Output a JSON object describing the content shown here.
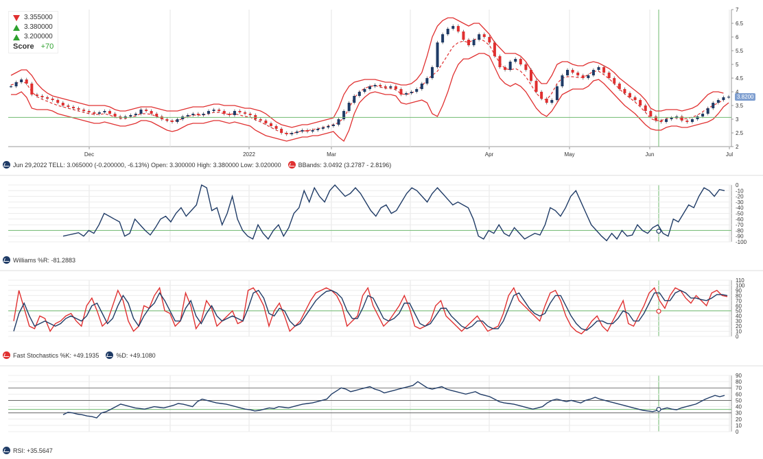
{
  "legend": {
    "items": [
      {
        "type": "down",
        "value": "3.355000"
      },
      {
        "type": "up",
        "value": "3.380000"
      },
      {
        "type": "up",
        "value": "3.200000"
      }
    ],
    "score_label": "Score",
    "score_value": "+70"
  },
  "price_caption": "Jun 29,2022 TELL: 3.065000 (-0.200000, -6.13%) Open: 3.300000 High: 3.380000 Low: 3.020000",
  "bbands_caption": "BBands: 3.0492  (3.2787  - 2.8196)",
  "williams_caption": "Williams %R: -81.2883",
  "stoch_k_caption": "Fast Stochastics %K: +49.1935",
  "stoch_d_caption": "%D: +49.1080",
  "rsi_caption": "RSI: +35.5647",
  "last_price_tag": "3.8200",
  "colors": {
    "price_up": "#1f3b66",
    "price_down": "#e03030",
    "band": "#e03030",
    "indicator": "#1f3b66",
    "crosshair": "#6fba6f"
  },
  "chart_data": [
    {
      "type": "line",
      "title": "",
      "series_name": "TELL",
      "x_ticks": [
        "Dec",
        "2022",
        "Mar",
        "Apr",
        "May",
        "Jun",
        "Jul"
      ],
      "y_ticks": [
        2,
        2.5,
        3,
        3.5,
        4,
        4.5,
        5,
        5.5,
        6,
        6.5,
        7
      ],
      "ylim": [
        2,
        7
      ],
      "close": [
        4.2,
        4.35,
        4.45,
        4.3,
        3.9,
        3.85,
        3.8,
        3.75,
        3.7,
        3.6,
        3.5,
        3.45,
        3.4,
        3.35,
        3.3,
        3.25,
        3.2,
        3.25,
        3.3,
        3.2,
        3.1,
        3.05,
        3.1,
        3.15,
        3.2,
        3.35,
        3.3,
        3.2,
        3.1,
        3.0,
        2.95,
        2.9,
        3.0,
        3.1,
        3.15,
        3.2,
        3.15,
        3.2,
        3.3,
        3.35,
        3.3,
        3.2,
        3.15,
        3.3,
        3.25,
        3.2,
        3.15,
        3.0,
        2.95,
        2.85,
        2.75,
        2.65,
        2.5,
        2.45,
        2.5,
        2.55,
        2.6,
        2.55,
        2.6,
        2.65,
        2.7,
        2.75,
        2.8,
        3.0,
        3.3,
        3.6,
        3.85,
        4.0,
        4.1,
        4.2,
        4.25,
        4.2,
        4.15,
        4.2,
        4.1,
        3.9,
        3.95,
        4.0,
        4.1,
        4.3,
        4.5,
        4.9,
        5.8,
        6.1,
        6.3,
        6.4,
        6.2,
        5.9,
        5.7,
        5.9,
        6.1,
        6.0,
        5.8,
        5.3,
        4.9,
        4.8,
        5.1,
        5.2,
        5.0,
        4.8,
        4.4,
        4.0,
        3.75,
        3.6,
        3.7,
        4.2,
        4.6,
        4.8,
        4.7,
        4.6,
        4.5,
        4.6,
        4.8,
        4.9,
        4.7,
        4.5,
        4.3,
        4.1,
        3.95,
        3.8,
        3.7,
        3.5,
        3.3,
        3.1,
        2.95,
        2.9,
        3.0,
        3.05,
        3.1,
        2.95,
        2.9,
        3.0,
        3.1,
        3.2,
        3.4,
        3.6,
        3.7,
        3.8,
        3.82
      ],
      "bb_upper": [
        4.6,
        4.7,
        4.8,
        4.8,
        4.6,
        4.3,
        4.1,
        3.95,
        3.85,
        3.8,
        3.75,
        3.7,
        3.65,
        3.6,
        3.55,
        3.5,
        3.5,
        3.5,
        3.5,
        3.45,
        3.35,
        3.3,
        3.3,
        3.35,
        3.4,
        3.45,
        3.45,
        3.45,
        3.4,
        3.35,
        3.3,
        3.3,
        3.3,
        3.35,
        3.4,
        3.45,
        3.45,
        3.45,
        3.5,
        3.55,
        3.55,
        3.5,
        3.5,
        3.5,
        3.45,
        3.4,
        3.4,
        3.35,
        3.3,
        3.2,
        3.05,
        2.9,
        2.8,
        2.75,
        2.7,
        2.75,
        2.8,
        2.8,
        2.85,
        2.9,
        2.95,
        3.0,
        3.05,
        3.4,
        3.9,
        4.2,
        4.35,
        4.4,
        4.45,
        4.45,
        4.45,
        4.4,
        4.35,
        4.35,
        4.3,
        4.25,
        4.25,
        4.3,
        4.45,
        4.7,
        5.3,
        6.0,
        6.4,
        6.6,
        6.7,
        6.7,
        6.6,
        6.5,
        6.4,
        6.5,
        6.5,
        6.3,
        6.1,
        5.8,
        5.6,
        5.4,
        5.4,
        5.4,
        5.3,
        5.1,
        4.8,
        4.5,
        4.3,
        4.3,
        4.6,
        5.0,
        5.1,
        5.1,
        5.0,
        4.95,
        4.95,
        5.05,
        5.1,
        5.05,
        4.95,
        4.85,
        4.7,
        4.5,
        4.35,
        4.2,
        4.05,
        3.9,
        3.7,
        3.4,
        3.3,
        3.3,
        3.35,
        3.35,
        3.35,
        3.3,
        3.35,
        3.4,
        3.5,
        3.7,
        3.9,
        4.0,
        4.0,
        3.95
      ],
      "bb_lower": [
        3.9,
        3.9,
        4.0,
        3.8,
        3.4,
        3.35,
        3.35,
        3.35,
        3.3,
        3.2,
        3.15,
        3.1,
        3.05,
        3.0,
        2.95,
        2.9,
        2.85,
        2.85,
        2.9,
        2.85,
        2.8,
        2.75,
        2.75,
        2.8,
        2.85,
        2.95,
        2.95,
        2.9,
        2.8,
        2.7,
        2.6,
        2.55,
        2.6,
        2.7,
        2.8,
        2.85,
        2.85,
        2.85,
        2.9,
        2.95,
        2.95,
        2.9,
        2.85,
        2.9,
        2.85,
        2.8,
        2.75,
        2.6,
        2.5,
        2.4,
        2.35,
        2.3,
        2.25,
        2.2,
        2.25,
        2.3,
        2.35,
        2.35,
        2.4,
        2.4,
        2.45,
        2.5,
        2.55,
        2.35,
        2.2,
        2.6,
        3.2,
        3.6,
        3.8,
        3.95,
        4.0,
        3.95,
        3.9,
        3.9,
        3.85,
        3.6,
        3.55,
        3.6,
        3.65,
        3.7,
        3.6,
        3.2,
        3.1,
        3.5,
        4.0,
        4.6,
        5.0,
        5.2,
        5.2,
        5.3,
        5.4,
        5.4,
        5.3,
        4.9,
        4.5,
        4.3,
        4.2,
        4.3,
        4.2,
        4.0,
        3.7,
        3.4,
        3.2,
        3.1,
        3.3,
        3.6,
        3.9,
        4.0,
        4.1,
        4.1,
        4.1,
        4.2,
        4.4,
        4.45,
        4.3,
        4.1,
        3.9,
        3.7,
        3.5,
        3.35,
        3.2,
        3.0,
        2.8,
        2.65,
        2.6,
        2.6,
        2.7,
        2.75,
        2.75,
        2.7,
        2.7,
        2.75,
        2.8,
        2.85,
        2.9,
        3.0,
        3.2,
        3.45,
        3.6
      ]
    },
    {
      "type": "line",
      "title": "",
      "series_name": "Williams %R",
      "y_ticks": [
        0,
        -10,
        -20,
        -30,
        -40,
        -50,
        -60,
        -70,
        -80,
        -90,
        -100
      ],
      "ylim": [
        -100,
        0
      ],
      "reference_lines": [
        -80
      ],
      "values": [
        -90,
        -88,
        -86,
        -84,
        -90,
        -80,
        -85,
        -70,
        -50,
        -55,
        -60,
        -65,
        -90,
        -85,
        -60,
        -70,
        -80,
        -88,
        -75,
        -60,
        -55,
        -65,
        -50,
        -40,
        -55,
        -45,
        -35,
        0,
        -5,
        -45,
        -40,
        -70,
        -50,
        -20,
        -60,
        -80,
        -90,
        -95,
        -70,
        -85,
        -95,
        -80,
        -70,
        -90,
        -75,
        -50,
        -40,
        -10,
        -30,
        -5,
        -20,
        -30,
        -10,
        0,
        -10,
        -20,
        -15,
        -5,
        -15,
        -30,
        -45,
        -55,
        -40,
        -35,
        -50,
        -45,
        -30,
        -15,
        -5,
        -10,
        -20,
        -30,
        -15,
        -5,
        -15,
        -25,
        -35,
        -30,
        -35,
        -40,
        -60,
        -90,
        -95,
        -80,
        -85,
        -70,
        -85,
        -90,
        -75,
        -85,
        -95,
        -90,
        -85,
        -88,
        -70,
        -40,
        -45,
        -55,
        -40,
        -20,
        -10,
        -30,
        -50,
        -70,
        -80,
        -90,
        -98,
        -85,
        -95,
        -80,
        -90,
        -88,
        -70,
        -80,
        -85,
        -75,
        -70,
        -85,
        -90,
        -60,
        -65,
        -50,
        -35,
        -40,
        -20,
        -5,
        -10,
        -20,
        -8,
        -10
      ],
      "last_value": -81.2883
    },
    {
      "type": "line",
      "title": "",
      "series": [
        {
          "name": "Fast Stochastics %K",
          "values": [
            30,
            90,
            55,
            20,
            15,
            40,
            35,
            10,
            25,
            30,
            40,
            45,
            30,
            20,
            60,
            75,
            50,
            20,
            30,
            60,
            90,
            70,
            30,
            10,
            20,
            60,
            55,
            80,
            95,
            50,
            45,
            20,
            30,
            85,
            60,
            15,
            30,
            70,
            55,
            20,
            30,
            40,
            50,
            25,
            30,
            90,
            95,
            80,
            60,
            20,
            50,
            65,
            40,
            10,
            20,
            30,
            50,
            70,
            85,
            90,
            95,
            90,
            80,
            60,
            20,
            30,
            40,
            80,
            95,
            60,
            40,
            20,
            30,
            45,
            60,
            80,
            55,
            20,
            15,
            20,
            30,
            60,
            70,
            40,
            30,
            20,
            10,
            20,
            30,
            40,
            25,
            10,
            15,
            20,
            45,
            80,
            95,
            70,
            60,
            50,
            40,
            30,
            60,
            85,
            90,
            70,
            40,
            20,
            10,
            5,
            15,
            30,
            40,
            20,
            10,
            30,
            50,
            70,
            25,
            20,
            40,
            60,
            85,
            95,
            70,
            55,
            80,
            95,
            90,
            75,
            65,
            80,
            70,
            60,
            85,
            90,
            80,
            78
          ],
          "last_value": 49.1935
        },
        {
          "name": "%D",
          "values": [
            10,
            45,
            65,
            40,
            20,
            25,
            30,
            25,
            20,
            25,
            35,
            40,
            35,
            30,
            40,
            60,
            65,
            45,
            25,
            35,
            60,
            80,
            65,
            35,
            20,
            40,
            55,
            65,
            85,
            70,
            50,
            30,
            30,
            55,
            70,
            40,
            25,
            45,
            60,
            40,
            30,
            35,
            40,
            35,
            30,
            55,
            85,
            90,
            75,
            45,
            40,
            55,
            50,
            30,
            20,
            25,
            40,
            55,
            70,
            80,
            88,
            90,
            85,
            75,
            50,
            35,
            35,
            55,
            80,
            75,
            55,
            35,
            30,
            35,
            45,
            65,
            65,
            45,
            25,
            20,
            25,
            40,
            55,
            55,
            40,
            30,
            20,
            15,
            20,
            30,
            30,
            20,
            15,
            15,
            30,
            55,
            80,
            85,
            70,
            55,
            45,
            40,
            45,
            65,
            80,
            80,
            60,
            40,
            25,
            15,
            12,
            20,
            30,
            30,
            25,
            25,
            35,
            50,
            45,
            30,
            30,
            45,
            65,
            85,
            85,
            70,
            70,
            85,
            90,
            85,
            75,
            75,
            72,
            70,
            75,
            82,
            82,
            80
          ],
          "last_value": 49.108
        }
      ],
      "y_ticks": [
        0,
        10,
        20,
        30,
        40,
        50,
        60,
        70,
        80,
        90,
        100,
        110
      ],
      "ylim": [
        0,
        110
      ],
      "reference_lines": [
        50
      ]
    },
    {
      "type": "line",
      "title": "",
      "series_name": "RSI",
      "y_ticks": [
        0,
        10,
        20,
        30,
        40,
        50,
        60,
        70,
        80,
        90
      ],
      "ylim": [
        0,
        90
      ],
      "reference_lines": [
        30,
        50,
        70
      ],
      "values": [
        27,
        31,
        30,
        28,
        27,
        25,
        24,
        22,
        30,
        32,
        36,
        40,
        44,
        42,
        40,
        38,
        37,
        36,
        38,
        40,
        39,
        38,
        40,
        42,
        45,
        44,
        42,
        40,
        48,
        52,
        50,
        48,
        46,
        45,
        44,
        42,
        40,
        38,
        36,
        35,
        33,
        34,
        36,
        38,
        37,
        40,
        39,
        38,
        40,
        42,
        44,
        45,
        46,
        48,
        50,
        52,
        60,
        65,
        70,
        68,
        64,
        66,
        68,
        70,
        72,
        68,
        66,
        62,
        64,
        66,
        68,
        70,
        72,
        74,
        80,
        75,
        70,
        68,
        70,
        72,
        68,
        66,
        64,
        62,
        60,
        62,
        64,
        60,
        58,
        56,
        52,
        48,
        46,
        45,
        44,
        42,
        40,
        38,
        36,
        38,
        40,
        46,
        50,
        52,
        50,
        48,
        50,
        48,
        46,
        50,
        52,
        55,
        52,
        50,
        48,
        46,
        44,
        42,
        40,
        38,
        36,
        34,
        33,
        32,
        34,
        36,
        38,
        36,
        35,
        38,
        40,
        42,
        44,
        48,
        52,
        55,
        58,
        56,
        58
      ]
    }
  ]
}
